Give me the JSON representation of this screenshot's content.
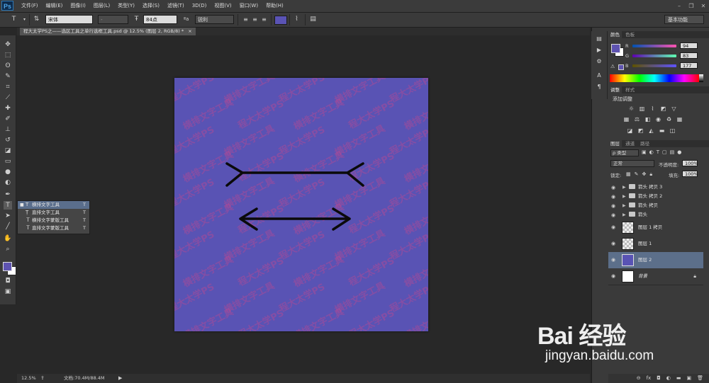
{
  "app": {
    "logo": "Ps"
  },
  "menu": [
    "文件(F)",
    "编辑(E)",
    "图像(I)",
    "图层(L)",
    "类型(Y)",
    "选择(S)",
    "滤镜(T)",
    "3D(D)",
    "视图(V)",
    "窗口(W)",
    "帮助(H)"
  ],
  "options_bar": {
    "font_family": "宋体",
    "font_style": "-",
    "font_size": "84点",
    "antialias_label": "ªa",
    "antialias": "锐利",
    "text_color": "#5a53b4",
    "workspace": "基本功能"
  },
  "document": {
    "tab_title": "程大太学PS之——选区工具之单行选框工具.psd @ 12.5% (图层 2, RGB/8) *",
    "canvas_color": "#5953b4",
    "watermark_text": [
      "程大太学PS",
      "横排文字工具"
    ]
  },
  "flyout": {
    "items": [
      {
        "label": "横排文字工具",
        "key": "T",
        "selected": true
      },
      {
        "label": "直排文字工具",
        "key": "T",
        "selected": false
      },
      {
        "label": "横排文字蒙版工具",
        "key": "T",
        "selected": false
      },
      {
        "label": "直排文字蒙版工具",
        "key": "T",
        "selected": false
      }
    ]
  },
  "status": {
    "zoom": "12.5%",
    "doc_info": "文档:70.4M/88.4M"
  },
  "color_panel": {
    "tabs": [
      "颜色",
      "色板"
    ],
    "r_label": "R",
    "g_label": "G",
    "b_label": "B",
    "r": "94",
    "g": "83",
    "b": "177",
    "fg_color": "#5e53b1"
  },
  "adjust_panel": {
    "tabs": [
      "调整",
      "样式"
    ],
    "title": "添加调整"
  },
  "layers_panel": {
    "tabs": [
      "图层",
      "通道",
      "路径"
    ],
    "filter_label": "ρ 类型",
    "blend_mode": "正常",
    "opacity_label": "不透明度:",
    "opacity": "100%",
    "lock_label": "锁定:",
    "fill_label": "填充:",
    "fill": "100%",
    "groups": [
      "箭头 拷贝 3",
      "箭头 拷贝 2",
      "箭头 拷贝",
      "箭头"
    ],
    "layers": [
      {
        "name": "图层 1 拷贝"
      },
      {
        "name": "图层 1"
      },
      {
        "name": "图层 2"
      },
      {
        "name": "背景"
      }
    ]
  },
  "overlay": {
    "logo": "Bai 经验",
    "url": "jingyan.baidu.com"
  }
}
